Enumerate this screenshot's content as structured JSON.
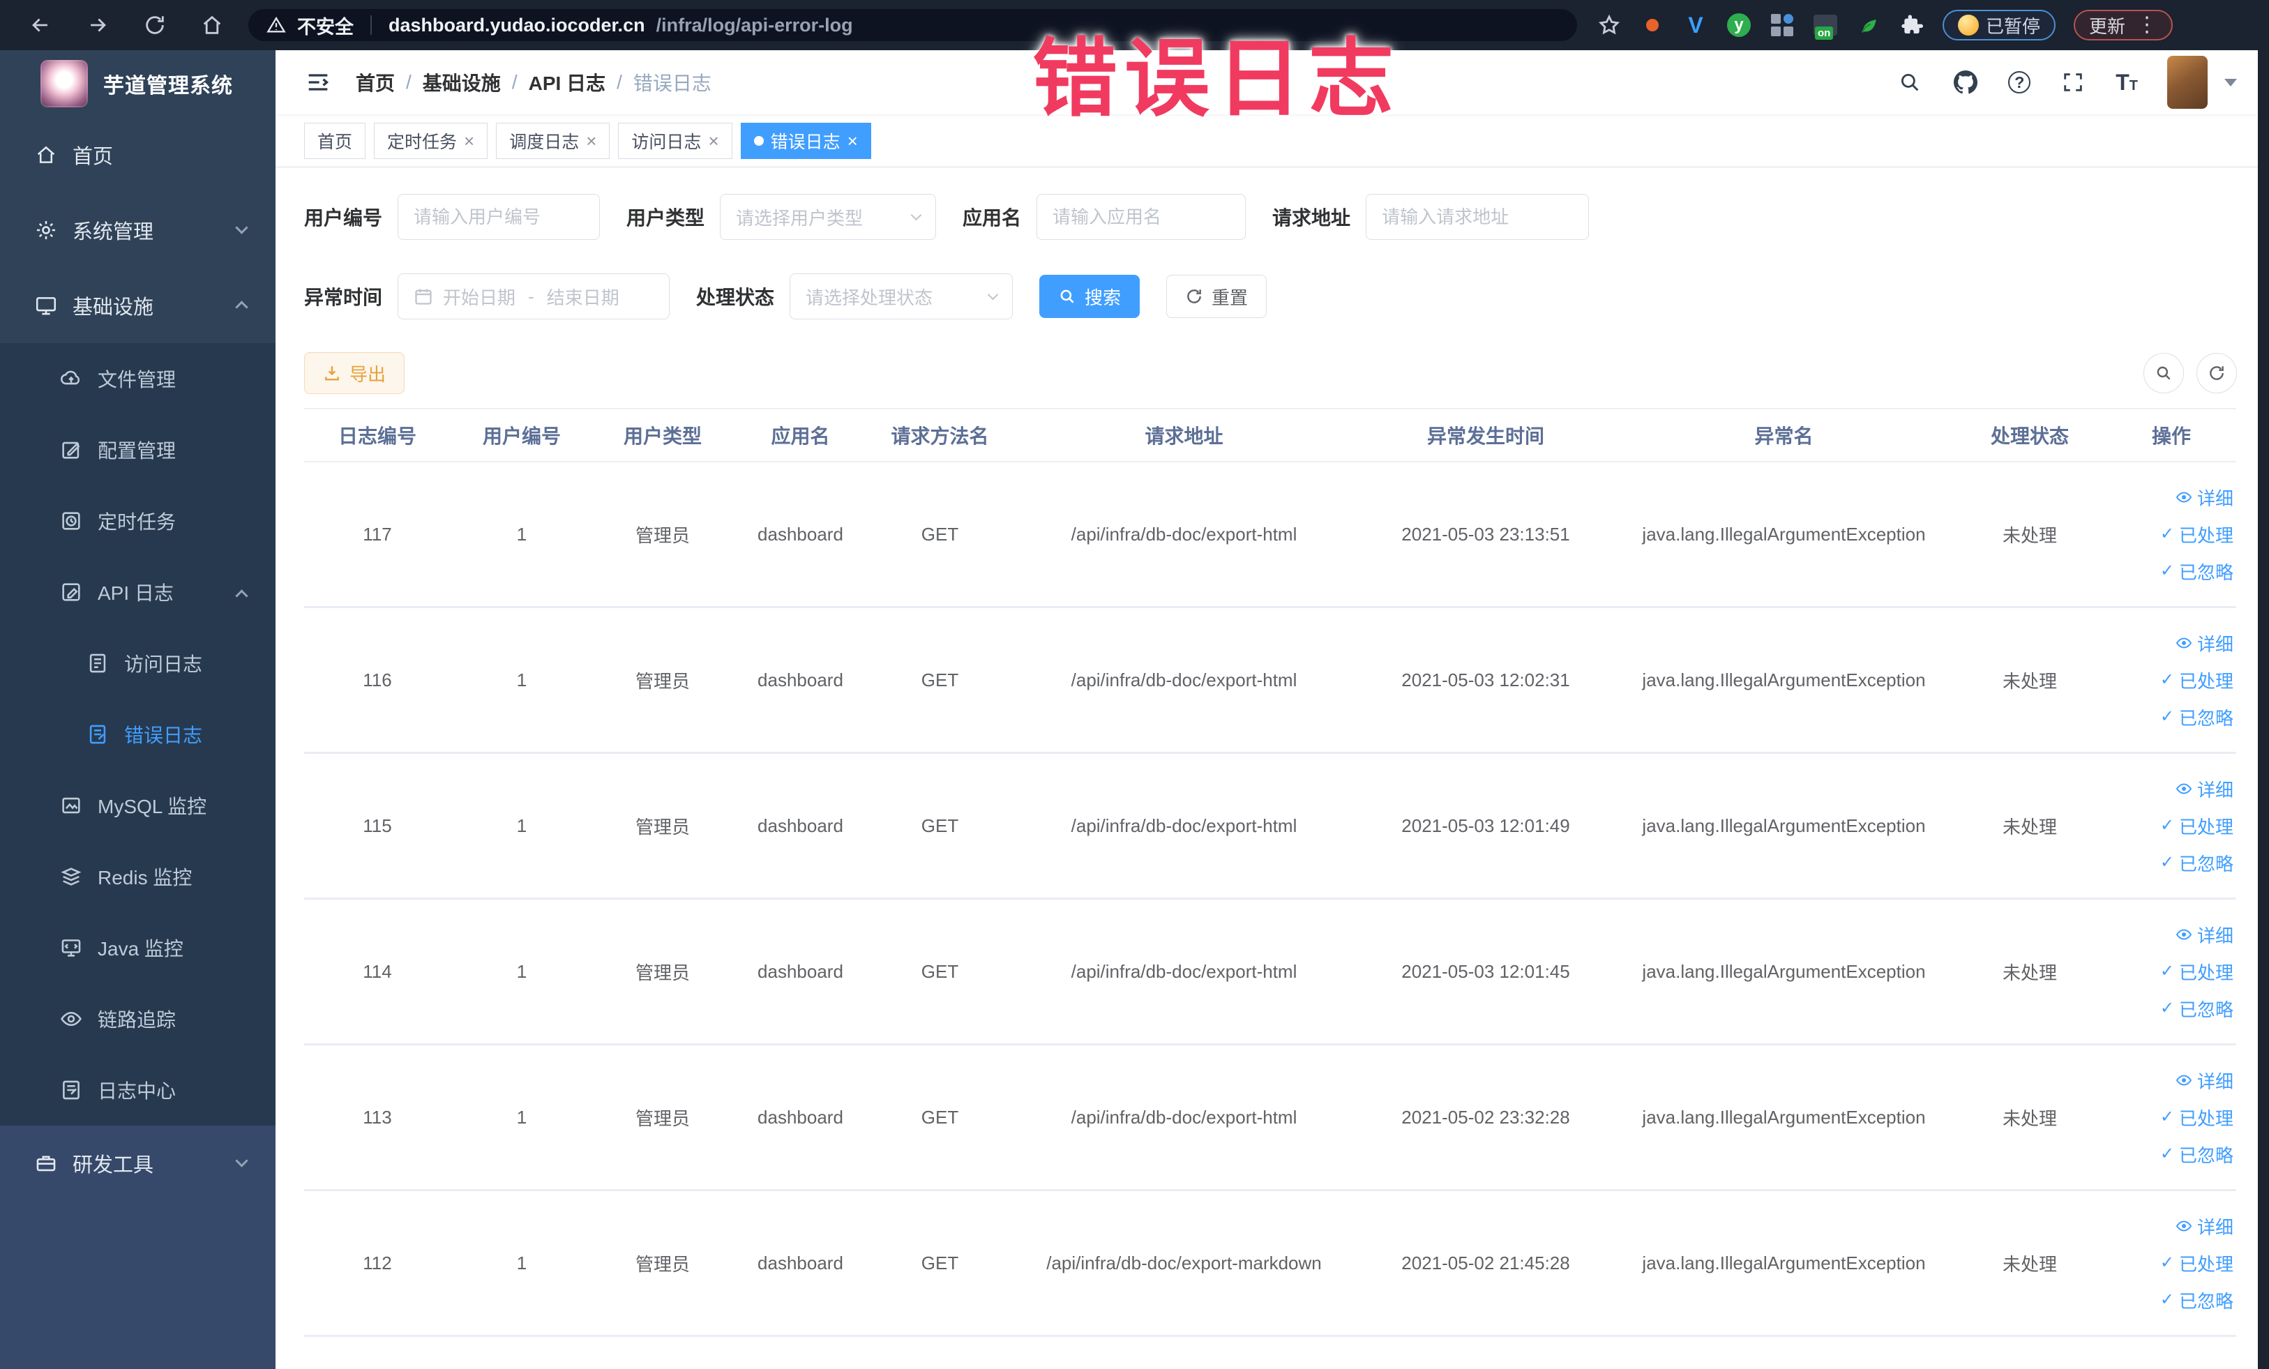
{
  "browser": {
    "security_label": "不安全",
    "url_domain": "dashboard.yudao.iocoder.cn",
    "url_path": "/infra/log/api-error-log",
    "paused_label": "已暂停",
    "update_label": "更新",
    "extension_on_badge": "on",
    "extension_y_glyph": "y",
    "extension_v_glyph": "V"
  },
  "annotation": {
    "title": "错误日志"
  },
  "sidebar": {
    "logo_title": "芋道管理系统",
    "items": [
      {
        "label": "首页"
      },
      {
        "label": "系统管理"
      },
      {
        "label": "基础设施"
      },
      {
        "label": "文件管理"
      },
      {
        "label": "配置管理"
      },
      {
        "label": "定时任务"
      },
      {
        "label": "API 日志"
      },
      {
        "label": "访问日志"
      },
      {
        "label": "错误日志"
      },
      {
        "label": "MySQL 监控"
      },
      {
        "label": "Redis 监控"
      },
      {
        "label": "Java 监控"
      },
      {
        "label": "链路追踪"
      },
      {
        "label": "日志中心"
      },
      {
        "label": "研发工具"
      }
    ]
  },
  "breadcrumb": {
    "items": [
      "首页",
      "基础设施",
      "API 日志",
      "错误日志"
    ],
    "separator": "/"
  },
  "tabs": [
    {
      "label": "首页"
    },
    {
      "label": "定时任务",
      "close": "×"
    },
    {
      "label": "调度日志",
      "close": "×"
    },
    {
      "label": "访问日志",
      "close": "×"
    },
    {
      "label": "错误日志",
      "close": "×",
      "active": true
    }
  ],
  "filters": {
    "user_id": {
      "label": "用户编号",
      "placeholder": "请输入用户编号"
    },
    "user_type": {
      "label": "用户类型",
      "placeholder": "请选择用户类型"
    },
    "app_name": {
      "label": "应用名",
      "placeholder": "请输入应用名"
    },
    "request_url": {
      "label": "请求地址",
      "placeholder": "请输入请求地址"
    },
    "exception_time": {
      "label": "异常时间",
      "start_placeholder": "开始日期",
      "separator": "-",
      "end_placeholder": "结束日期"
    },
    "process_status": {
      "label": "处理状态",
      "placeholder": "请选择处理状态"
    },
    "search_label": "搜索",
    "reset_label": "重置"
  },
  "toolbar": {
    "export_label": "导出"
  },
  "table": {
    "columns": [
      "日志编号",
      "用户编号",
      "用户类型",
      "应用名",
      "请求方法名",
      "请求地址",
      "异常发生时间",
      "异常名",
      "处理状态",
      "操作"
    ],
    "row_actions": {
      "detail": "详细",
      "processed": "已处理",
      "ignored": "已忽略"
    },
    "rows": [
      {
        "id": "117",
        "user_id": "1",
        "user_type": "管理员",
        "app": "dashboard",
        "method": "GET",
        "url": "/api/infra/db-doc/export-html",
        "time": "2021-05-03 23:13:51",
        "exception": "java.lang.IllegalArgumentException",
        "status": "未处理"
      },
      {
        "id": "116",
        "user_id": "1",
        "user_type": "管理员",
        "app": "dashboard",
        "method": "GET",
        "url": "/api/infra/db-doc/export-html",
        "time": "2021-05-03 12:02:31",
        "exception": "java.lang.IllegalArgumentException",
        "status": "未处理"
      },
      {
        "id": "115",
        "user_id": "1",
        "user_type": "管理员",
        "app": "dashboard",
        "method": "GET",
        "url": "/api/infra/db-doc/export-html",
        "time": "2021-05-03 12:01:49",
        "exception": "java.lang.IllegalArgumentException",
        "status": "未处理"
      },
      {
        "id": "114",
        "user_id": "1",
        "user_type": "管理员",
        "app": "dashboard",
        "method": "GET",
        "url": "/api/infra/db-doc/export-html",
        "time": "2021-05-03 12:01:45",
        "exception": "java.lang.IllegalArgumentException",
        "status": "未处理"
      },
      {
        "id": "113",
        "user_id": "1",
        "user_type": "管理员",
        "app": "dashboard",
        "method": "GET",
        "url": "/api/infra/db-doc/export-html",
        "time": "2021-05-02 23:32:28",
        "exception": "java.lang.IllegalArgumentException",
        "status": "未处理"
      },
      {
        "id": "112",
        "user_id": "1",
        "user_type": "管理员",
        "app": "dashboard",
        "method": "GET",
        "url": "/api/infra/db-doc/export-markdown",
        "time": "2021-05-02 21:45:28",
        "exception": "java.lang.IllegalArgumentException",
        "status": "未处理"
      }
    ]
  },
  "colors": {
    "accent": "#409eff",
    "warning": "#e6a23c",
    "annotation": "#f13a5f",
    "sidebar_bg": "#2f4258",
    "browser_bar_bg": "#1b2230"
  }
}
